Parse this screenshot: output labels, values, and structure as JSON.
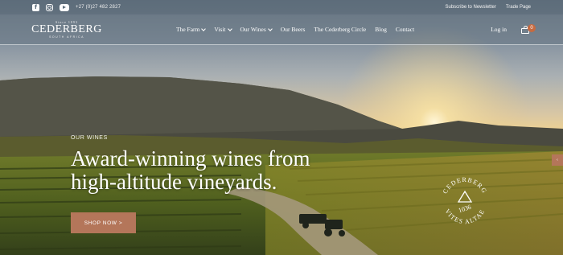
{
  "topbar": {
    "social": [
      {
        "icon": "facebook-icon"
      },
      {
        "icon": "instagram-icon"
      },
      {
        "icon": "youtube-icon"
      }
    ],
    "phone": "+27 (0)27 482 2827",
    "links": [
      "Subscribe to Newsletter",
      "Trade Page"
    ]
  },
  "logo": {
    "since": "Since 1893",
    "brand": "CEDERBERG",
    "country": "SOUTH AFRICA"
  },
  "nav": {
    "items": [
      {
        "label": "The Farm",
        "dropdown": true
      },
      {
        "label": "Visit",
        "dropdown": true
      },
      {
        "label": "Our Wines",
        "dropdown": true
      },
      {
        "label": "Our Beers",
        "dropdown": false
      },
      {
        "label": "The Cederberg Circle",
        "dropdown": false
      },
      {
        "label": "Blog",
        "dropdown": false
      },
      {
        "label": "Contact",
        "dropdown": false
      }
    ],
    "login": "Log in",
    "cart_count": "0"
  },
  "hero": {
    "eyebrow": "OUR WINES",
    "headline": "Award-winning wines from high-altitude vineyards.",
    "cta": "SHOP NOW >",
    "emblem": {
      "top_text": "CEDERBERG",
      "bottom_text": "VITES ALTAE",
      "number": "1036"
    }
  },
  "colors": {
    "accent": "#b4765a",
    "badge": "#c66a40"
  }
}
